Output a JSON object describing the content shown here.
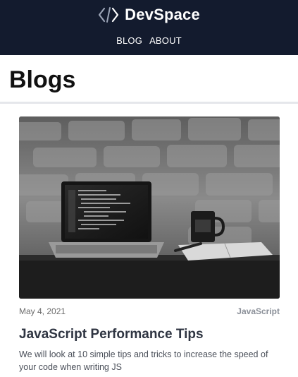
{
  "header": {
    "brand_icon": "code-brackets-icon",
    "brand_name": "DevSpace",
    "nav": [
      {
        "label": "BLOG"
      },
      {
        "label": "ABOUT"
      }
    ]
  },
  "page": {
    "title": "Blogs"
  },
  "post": {
    "image_icon": "laptop-on-desk-photo",
    "date": "May 4, 2021",
    "category": "JavaScript",
    "title": "JavaScript Performance Tips",
    "excerpt": "We will look at 10 simple tips and tricks to increase the speed of your code when writing JS"
  },
  "colors": {
    "header_bg": "#131b2e",
    "category": "#8a8f98"
  }
}
